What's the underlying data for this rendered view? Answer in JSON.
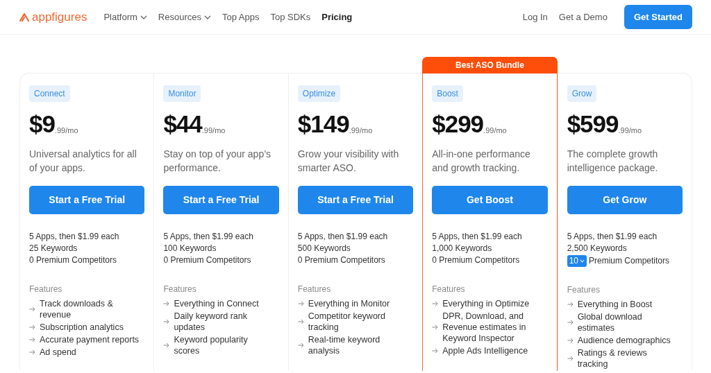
{
  "nav": {
    "logo": "appfigures",
    "links": [
      {
        "label": "Platform",
        "has_menu": true,
        "selected": false
      },
      {
        "label": "Resources",
        "has_menu": true,
        "selected": false
      },
      {
        "label": "Top Apps",
        "has_menu": false,
        "selected": false
      },
      {
        "label": "Top SDKs",
        "has_menu": false,
        "selected": false
      },
      {
        "label": "Pricing",
        "has_menu": false,
        "selected": true
      }
    ],
    "right_links": [
      "Log In",
      "Get a Demo"
    ],
    "cta": "Get Started"
  },
  "plans": [
    {
      "name": "Connect",
      "price": "$9",
      "cents": ".99/mo",
      "description": "Universal analytics for all of your apps.",
      "button": "Start a Free Trial",
      "featured": false,
      "limits": [
        {
          "kind": "text",
          "text": "5 Apps, then $1.99 each"
        },
        {
          "kind": "text",
          "text": "25 Keywords"
        },
        {
          "kind": "text",
          "text": "0 Premium Competitors"
        }
      ],
      "features_title": "Features",
      "features": [
        "Track downloads & revenue",
        "Subscription analytics",
        "Accurate payment reports",
        "Ad spend"
      ]
    },
    {
      "name": "Monitor",
      "price": "$44",
      "cents": ".99/mo",
      "description": "Stay on top of your app’s performance.",
      "button": "Start a Free Trial",
      "featured": false,
      "limits": [
        {
          "kind": "text",
          "text": "5 Apps, then $1.99 each"
        },
        {
          "kind": "text",
          "text": "100 Keywords"
        },
        {
          "kind": "text",
          "text": "0 Premium Competitors"
        }
      ],
      "features_title": "Features",
      "features": [
        "Everything in Connect",
        "Daily keyword rank updates",
        "Keyword popularity scores"
      ]
    },
    {
      "name": "Optimize",
      "price": "$149",
      "cents": ".99/mo",
      "description": "Grow your visibility with smarter ASO.",
      "button": "Start a Free Trial",
      "featured": false,
      "limits": [
        {
          "kind": "text",
          "text": "5 Apps, then $1.99 each"
        },
        {
          "kind": "text",
          "text": "500 Keywords"
        },
        {
          "kind": "text",
          "text": "0 Premium Competitors"
        }
      ],
      "features_title": "Features",
      "features": [
        "Everything in Monitor",
        "Competitor keyword tracking",
        "Real-time keyword analysis"
      ]
    },
    {
      "name": "Boost",
      "price": "$299",
      "cents": ".99/mo",
      "description": "All-in-one performance and growth tracking.",
      "button": "Get Boost",
      "featured": true,
      "ribbon": "Best ASO Bundle",
      "limits": [
        {
          "kind": "text",
          "text": "5 Apps, then $1.99 each"
        },
        {
          "kind": "text",
          "text": "1,000 Keywords"
        },
        {
          "kind": "text",
          "text": "0 Premium Competitors"
        }
      ],
      "features_title": "Features",
      "features": [
        "Everything in Optimize",
        "DPR, Download, and Revenue estimates in Keyword Inspector",
        "Apple Ads Intelligence"
      ]
    },
    {
      "name": "Grow",
      "price": "$599",
      "cents": ".99/mo",
      "description": "The complete growth intelligence package.",
      "button": "Get Grow",
      "featured": false,
      "limits": [
        {
          "kind": "text",
          "text": "5 Apps, then $1.99 each"
        },
        {
          "kind": "text",
          "text": "2,500 Keywords"
        },
        {
          "kind": "select",
          "value": "10",
          "text": "Premium Competitors"
        }
      ],
      "features_title": "Features",
      "features": [
        "Everything in Boost",
        "Global download estimates",
        "Audience demographics",
        "Ratings & reviews tracking"
      ]
    }
  ]
}
